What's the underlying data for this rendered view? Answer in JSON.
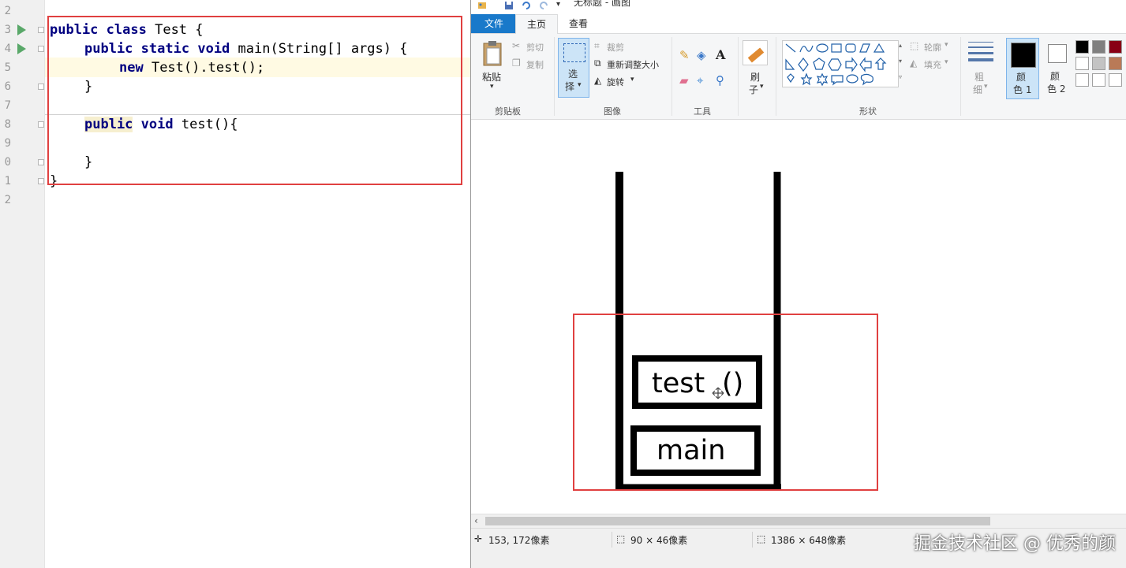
{
  "editor": {
    "line_numbers": [
      "2",
      "3",
      "4",
      "5",
      "6",
      "7",
      "8",
      "9",
      "0",
      "1",
      "2"
    ],
    "code": {
      "line1": {
        "kw1": "public",
        "kw2": "class",
        "rest": " Test {"
      },
      "line2": {
        "kw1": "public",
        "kw2": "static",
        "kw3": "void",
        "rest": " main(String[] args) {"
      },
      "line3": {
        "kw1": "new",
        "rest": " Test().test();"
      },
      "line4": "}",
      "line6": {
        "kw1": "public",
        "kw2": "void",
        "rest": " test(){"
      },
      "line8": "}",
      "line9": "}"
    }
  },
  "paint": {
    "title": "无标题 - 画图",
    "tabs": {
      "file": "文件",
      "home": "主页",
      "view": "查看"
    },
    "clipboard": {
      "paste": "粘贴",
      "cut": "剪切",
      "copy": "复制",
      "group": "剪贴板"
    },
    "image": {
      "select_1": "选",
      "select_2": "择",
      "crop": "裁剪",
      "resize": "重新调整大小",
      "rotate": "旋转",
      "group": "图像"
    },
    "tools": {
      "group": "工具",
      "text_tool": "A"
    },
    "brush": {
      "label_1": "刷",
      "label_2": "子"
    },
    "shapes": {
      "outline": "轮廓",
      "fill": "填充",
      "group": "形状"
    },
    "size": {
      "label_1": "粗",
      "label_2": "细"
    },
    "color1": {
      "label_1": "颜",
      "label_2": "色 1"
    },
    "color2": {
      "label_1": "颜",
      "label_2": "色 2"
    },
    "palette": [
      "#000000",
      "#7f7f7f",
      "#880015",
      "#ffffff",
      "#c3c3c3",
      "#b97a57",
      "#ffffff",
      "#ffffff",
      "#ffffff"
    ],
    "canvas": {
      "frame_top": "test",
      "frame_top_parens": "()",
      "frame_bottom": "main"
    },
    "status": {
      "cursor": "153, 172像素",
      "selection": "90 × 46像素",
      "image_size": "1386 × 648像素"
    },
    "watermark": "掘金技术社区 @ 优秀的颜"
  },
  "colors": {
    "accent": "#1979ca",
    "highlight_box": "#e04040",
    "run_icon": "#59a869"
  }
}
